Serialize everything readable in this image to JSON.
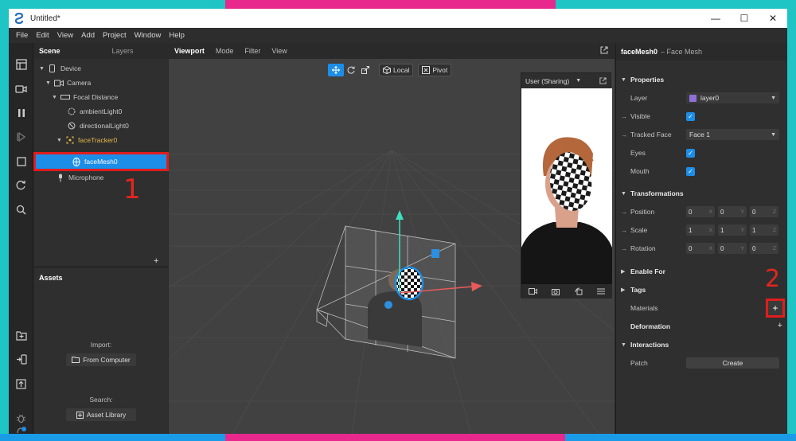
{
  "window": {
    "title": "Untitled*",
    "minimize": "—",
    "maximize": "☐",
    "close": "✕"
  },
  "menubar": [
    "File",
    "Edit",
    "View",
    "Add",
    "Project",
    "Window",
    "Help"
  ],
  "scene": {
    "tab_scene": "Scene",
    "tab_layers": "Layers",
    "items": [
      {
        "label": "Device"
      },
      {
        "label": "Camera"
      },
      {
        "label": "Focal Distance"
      },
      {
        "label": "ambientLight0"
      },
      {
        "label": "directionalLight0"
      },
      {
        "label": "faceTracker0"
      },
      {
        "label": "faceMesh0"
      },
      {
        "label": "Microphone"
      }
    ],
    "add": "+"
  },
  "annotations": {
    "one": "1",
    "two": "2"
  },
  "assets": {
    "title": "Assets",
    "import_label": "Import:",
    "from_computer": "From Computer",
    "search_label": "Search:",
    "asset_library": "Asset Library"
  },
  "viewport": {
    "tabs": [
      "Viewport",
      "Mode",
      "Filter",
      "View"
    ],
    "local": "Local",
    "pivot": "Pivot",
    "preview_title": "User (Sharing)"
  },
  "properties": {
    "object_name": "faceMesh0",
    "object_type": "– Face Mesh",
    "sec_properties": "Properties",
    "layer_label": "Layer",
    "layer_value": "layer0",
    "layer_color": "#8f6fd8",
    "visible_label": "Visible",
    "tracked_face_label": "Tracked Face",
    "tracked_face_value": "Face 1",
    "eyes_label": "Eyes",
    "mouth_label": "Mouth",
    "sec_transformations": "Transformations",
    "position_label": "Position",
    "position": [
      "0",
      "0",
      "0"
    ],
    "scale_label": "Scale",
    "scale": [
      "1",
      "1",
      "1"
    ],
    "rotation_label": "Rotation",
    "rotation": [
      "0",
      "0",
      "0"
    ],
    "axes": [
      "X",
      "Y",
      "Z"
    ],
    "sec_enable_for": "Enable For",
    "sec_tags": "Tags",
    "materials_label": "Materials",
    "sec_deformation": "Deformation",
    "sec_interactions": "Interactions",
    "patch_label": "Patch",
    "create": "Create",
    "plus": "+"
  },
  "colors": {
    "accent": "#1d8ee8",
    "highlight_red": "#e01d1d"
  }
}
